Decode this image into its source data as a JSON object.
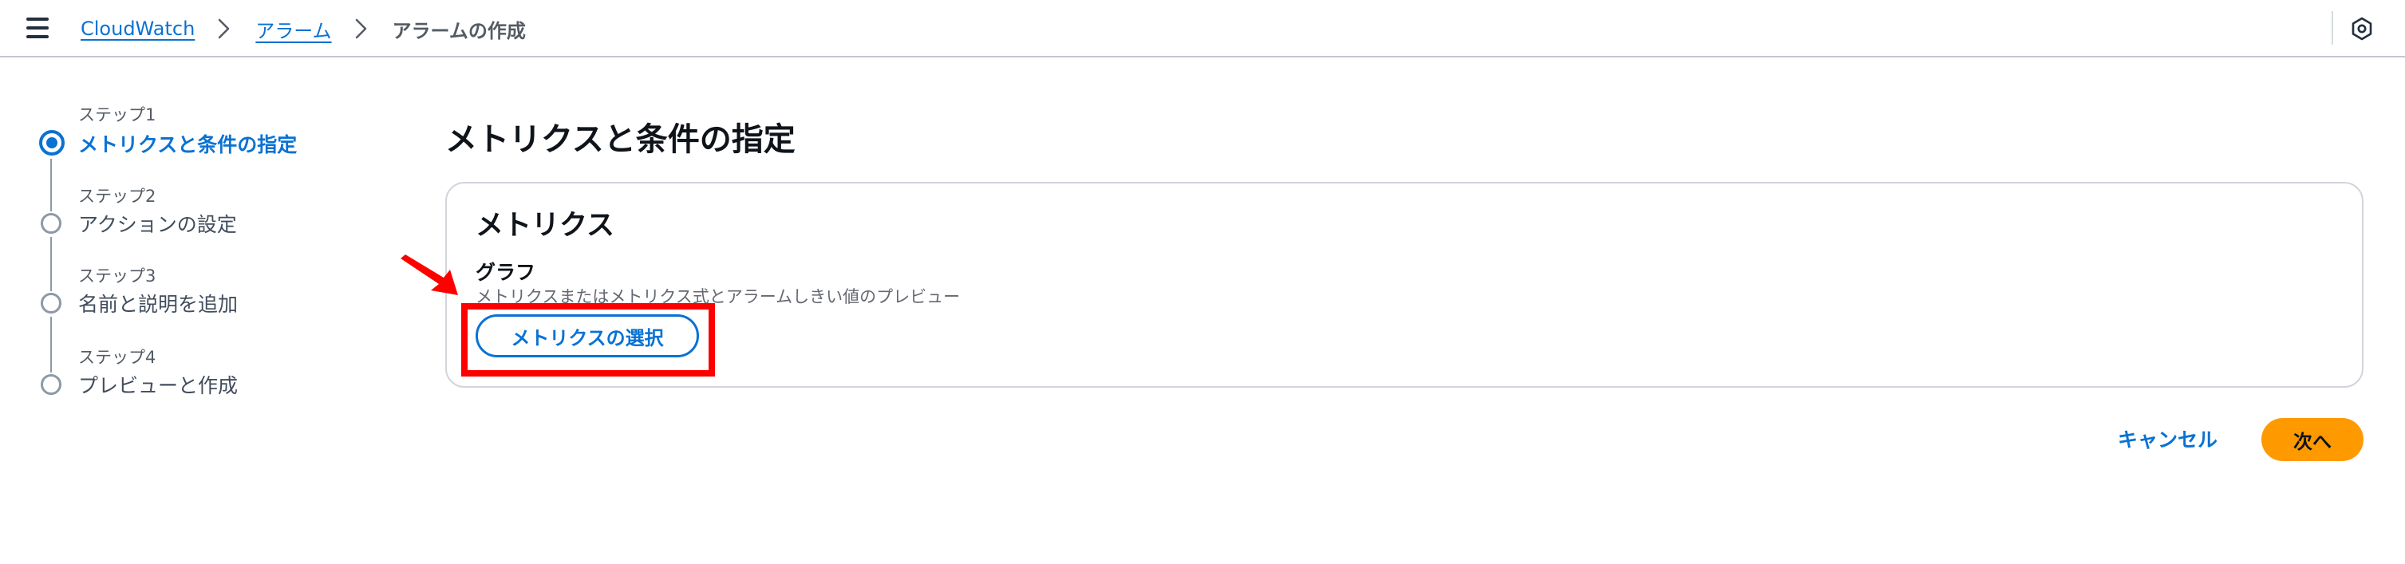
{
  "header": {
    "breadcrumb": {
      "root": "CloudWatch",
      "section": "アラーム",
      "current": "アラームの作成"
    }
  },
  "steps": [
    {
      "number": "ステップ1",
      "title": "メトリクスと条件の指定",
      "active": true
    },
    {
      "number": "ステップ2",
      "title": "アクションの設定",
      "active": false
    },
    {
      "number": "ステップ3",
      "title": "名前と説明を追加",
      "active": false
    },
    {
      "number": "ステップ4",
      "title": "プレビューと作成",
      "active": false
    }
  ],
  "main": {
    "page_title": "メトリクスと条件の指定",
    "panel": {
      "title": "メトリクス",
      "graph_label": "グラフ",
      "graph_description": "メトリクスまたはメトリクス式とアラームしきい値のプレビュー",
      "select_metric_label": "メトリクスの選択"
    }
  },
  "footer": {
    "cancel_label": "キャンセル",
    "next_label": "次へ"
  },
  "colors": {
    "link": "#0972d3",
    "primary_button": "#ff9900",
    "annotation": "#ff0000"
  },
  "icons": {
    "menu": "menu-icon",
    "breadcrumb_separator": "chevron-right-icon",
    "settings": "settings-icon",
    "annotation_arrow": "arrow-icon"
  }
}
